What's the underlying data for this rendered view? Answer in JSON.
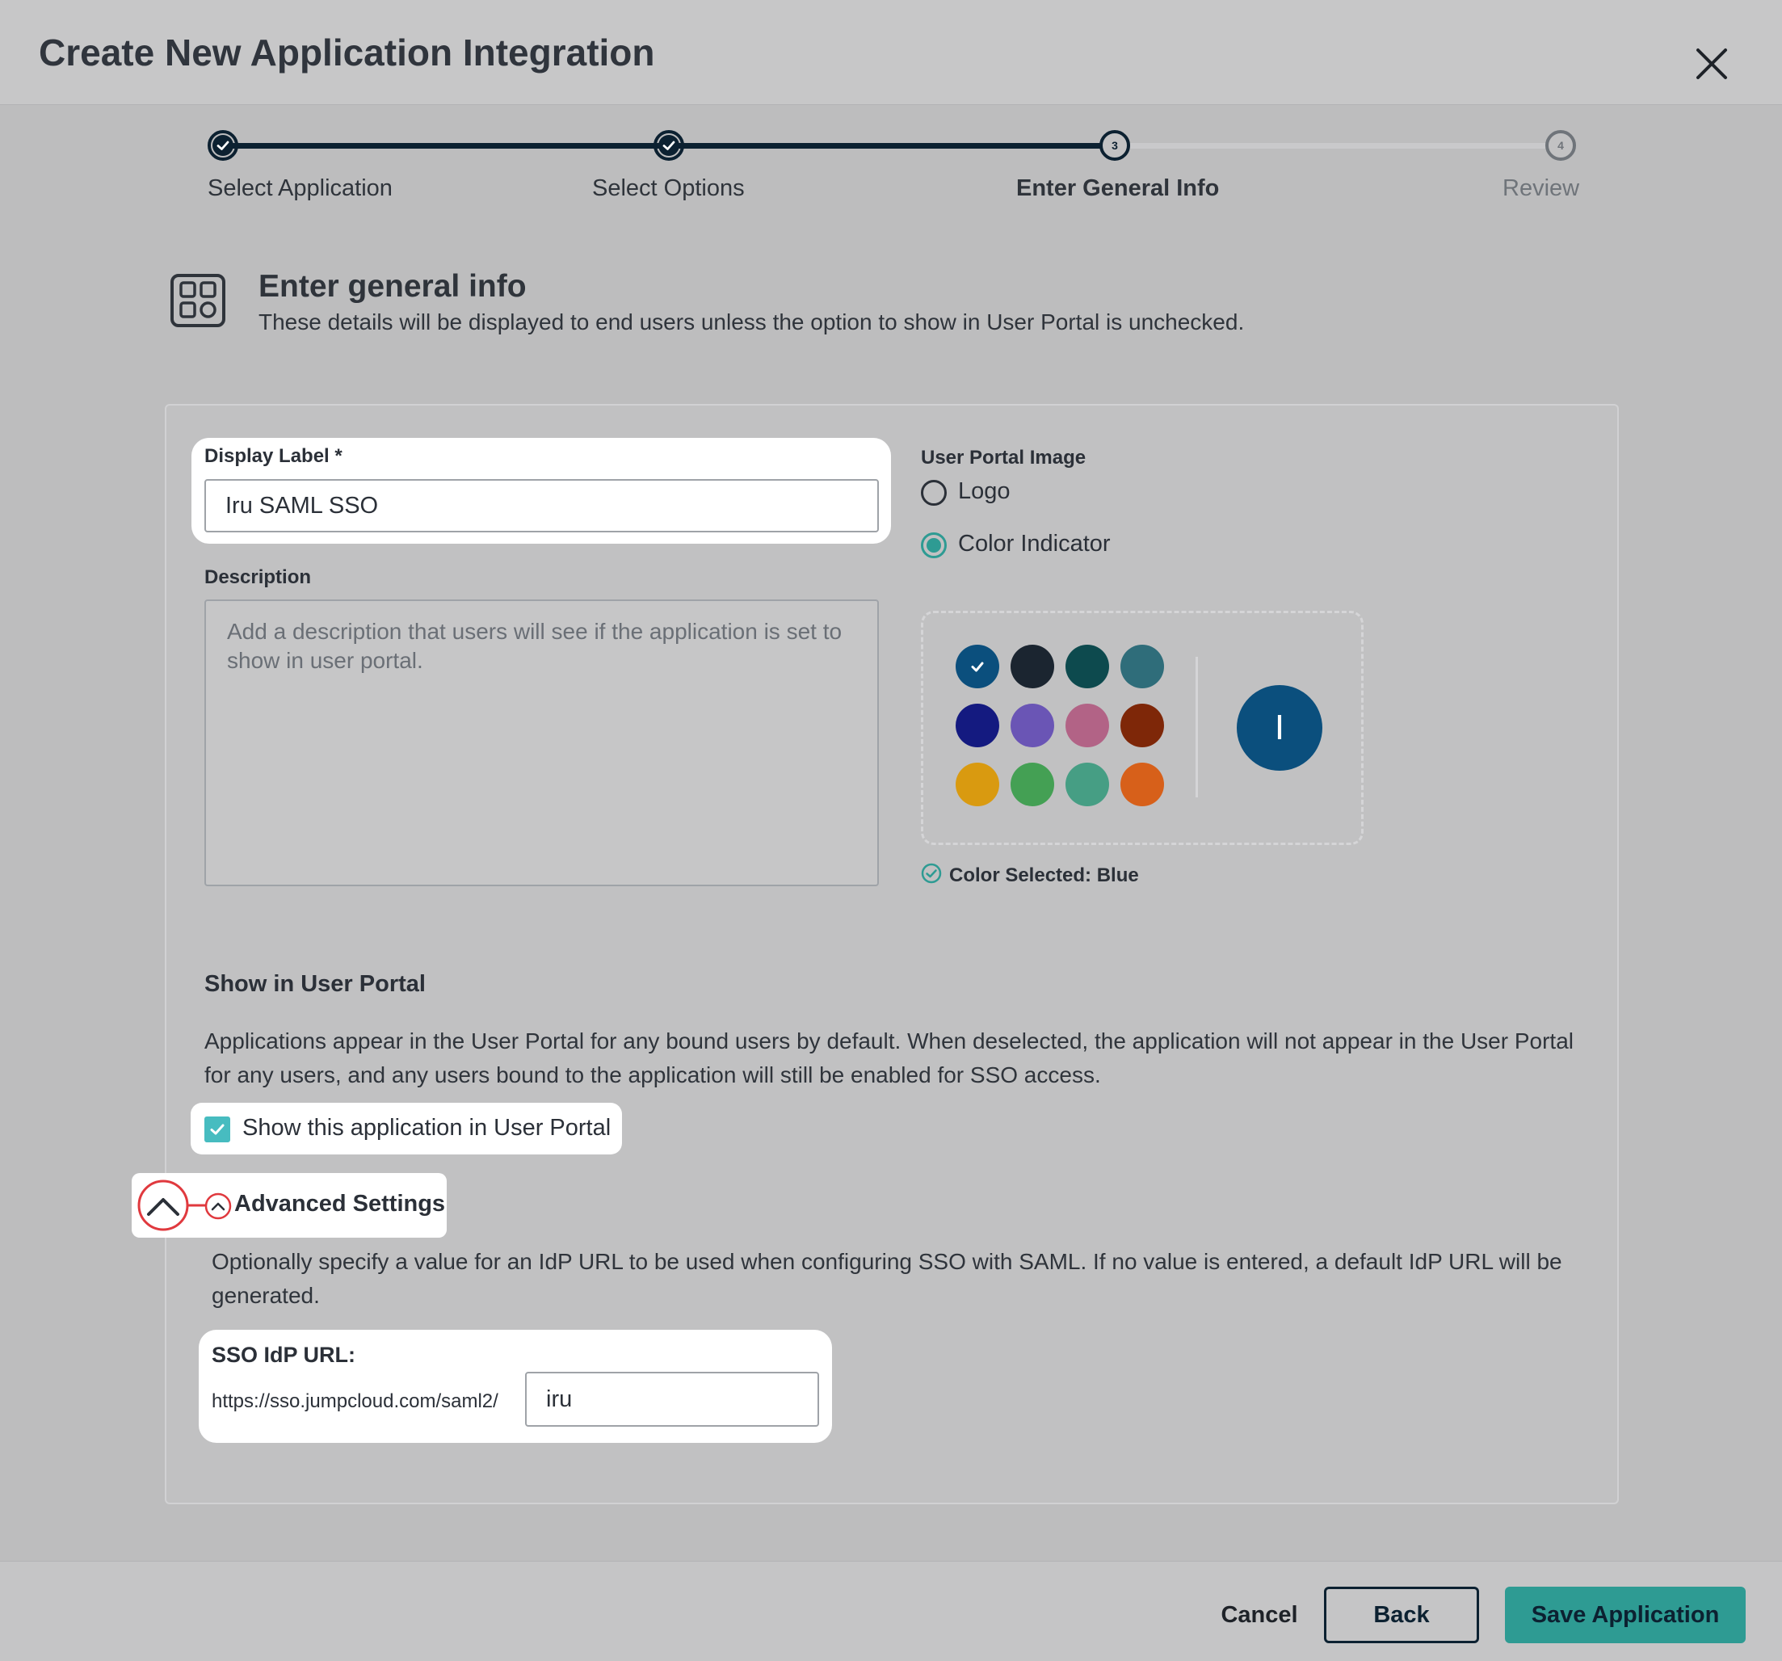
{
  "dialog": {
    "title": "Create New Application Integration"
  },
  "stepper": {
    "steps": [
      {
        "label": "Select Application",
        "state": "complete"
      },
      {
        "label": "Select Options",
        "state": "complete"
      },
      {
        "label": "Enter General Info",
        "state": "current",
        "number": "3"
      },
      {
        "label": "Review",
        "state": "upcoming",
        "number": "4"
      }
    ]
  },
  "section": {
    "title": "Enter general info",
    "subtitle": "These details will be displayed to end users unless the option to show in User Portal is unchecked."
  },
  "form": {
    "display_label": {
      "label": "Display Label *",
      "value": "Iru SAML SSO"
    },
    "description": {
      "label": "Description",
      "placeholder": "Add a description that users will see if the application is set to show in user portal."
    },
    "portal_image": {
      "label": "User Portal Image",
      "options": [
        {
          "label": "Logo",
          "selected": false
        },
        {
          "label": "Color Indicator",
          "selected": true
        }
      ],
      "swatches": [
        "#0b4f7d",
        "#1b2530",
        "#0d4a4e",
        "#2f6d7a",
        "#141a80",
        "#6a55b5",
        "#b26386",
        "#7e2708",
        "#d99a10",
        "#44a054",
        "#469e84",
        "#d7601a"
      ],
      "selected_swatch": 0,
      "preview_letter": "I",
      "color_selected_text": "Color Selected: Blue"
    },
    "show_in_portal": {
      "heading": "Show in User Portal",
      "description": "Applications appear in the User Portal for any bound users by default. When deselected, the application will not appear in the User Portal for any users, and any users bound to the application will still be enabled for SSO access.",
      "checkbox_label": "Show this application in User Portal",
      "checked": true
    },
    "advanced": {
      "toggle_label": "Advanced Settings",
      "description": "Optionally specify a value for an IdP URL to be used when configuring SSO with SAML. If no value is entered, a default IdP URL will be generated.",
      "sso_label": "SSO IdP URL:",
      "url_prefix": "https://sso.jumpcloud.com/saml2/",
      "url_value": "iru"
    }
  },
  "footer": {
    "cancel": "Cancel",
    "back": "Back",
    "save": "Save Application"
  },
  "colors": {
    "accent": "#2e9b93",
    "navy": "#0c2131",
    "annotation_red": "#e0393e"
  }
}
